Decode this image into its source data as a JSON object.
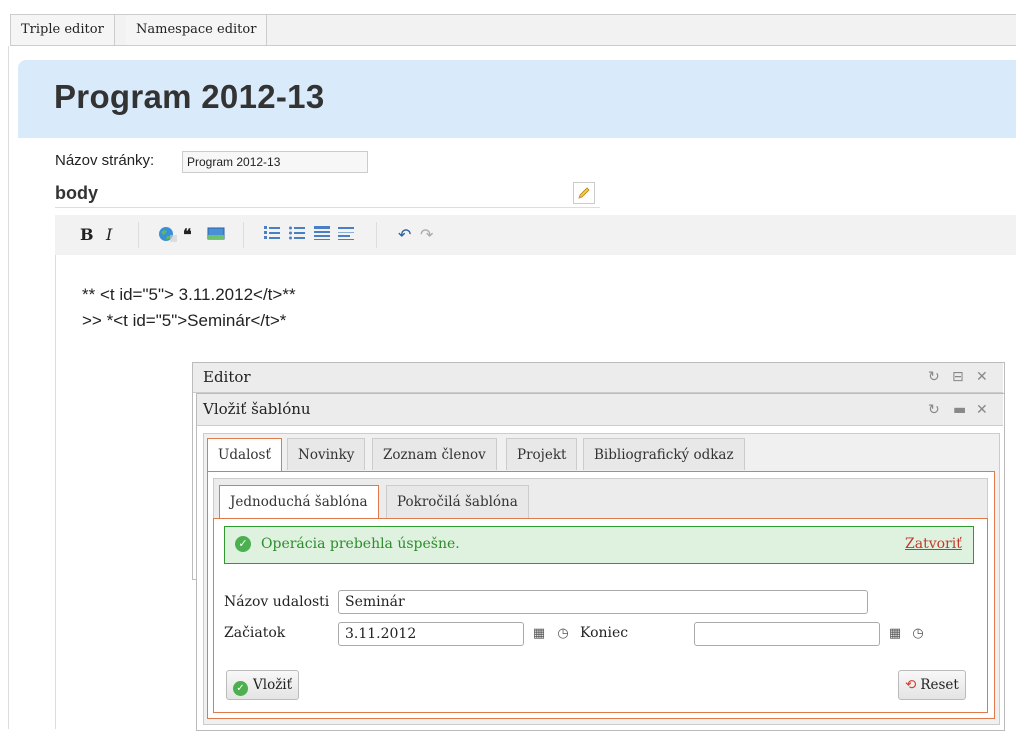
{
  "top_tabs": [
    "Triple editor",
    "Namespace editor"
  ],
  "page": {
    "title": "Program 2012-13",
    "name_label": "Názov stránky:",
    "name_value": "Program 2012-13",
    "body_label": "body"
  },
  "toolbar": {
    "bold": "B",
    "italic": "I",
    "quote": "❝",
    "undo": "↶",
    "redo": "↷"
  },
  "content_lines": [
    "** <t id=\"5\"> 3.11.2012</t>**",
    ">> *<t id=\"5\">Seminár</t>*"
  ],
  "editor_window": {
    "title": "Editor"
  },
  "insert_window": {
    "title": "Vložiť šablónu"
  },
  "outer_tabs": [
    "Udalosť",
    "Novinky",
    "Zoznam členov",
    "Projekt",
    "Bibliografický odkaz"
  ],
  "inner_tabs": [
    "Jednoduchá šablóna",
    "Pokročilá šablóna"
  ],
  "message": {
    "text": "Operácia prebehla úspešne.",
    "close_label": "Zatvoriť"
  },
  "form": {
    "event_name_label": "Názov udalosti",
    "event_name_value": "Seminár",
    "start_label": "Začiatok",
    "start_value": "3.11.2012",
    "end_label": "Koniec",
    "end_value": ""
  },
  "buttons": {
    "insert": "Vložiť",
    "reset": "Reset"
  },
  "colors": {
    "title_bar": "#d9ebfb",
    "success_bg": "#dff2df",
    "success_border": "#2f9b2f",
    "active_tab_border": "#e07a4a",
    "close_link": "#c0392b"
  }
}
